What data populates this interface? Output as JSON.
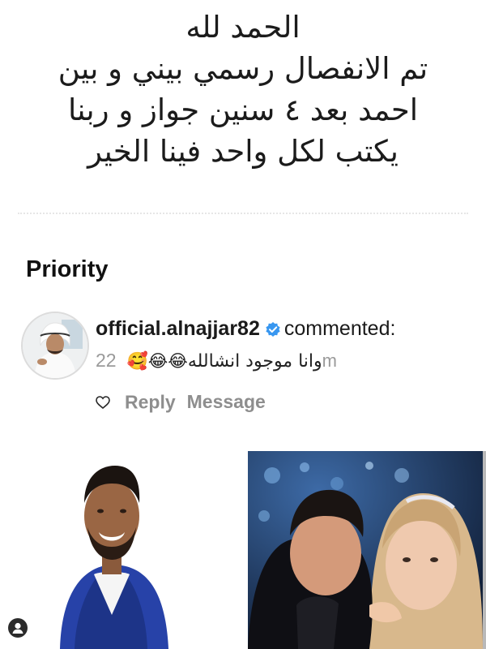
{
  "post": {
    "lines": [
      "الحمد لله",
      "تم الانفصال رسمي بيني و بين",
      "احمد بعد ٤ سنين جواز و ربنا",
      "يكتب لكل واحد فينا الخير"
    ]
  },
  "section": {
    "title": "Priority"
  },
  "comment": {
    "username": "official.alnajjar82",
    "action": "commented:",
    "text": "وانا موجود انشالله",
    "trail": "m",
    "emojis": [
      "😂",
      "😂",
      "🥰"
    ],
    "like_count": "22"
  },
  "actions": {
    "reply_label": "Reply",
    "message_label": "Message"
  },
  "colors": {
    "verified_badge": "#3897f0",
    "muted_text": "#8e8e8e"
  }
}
